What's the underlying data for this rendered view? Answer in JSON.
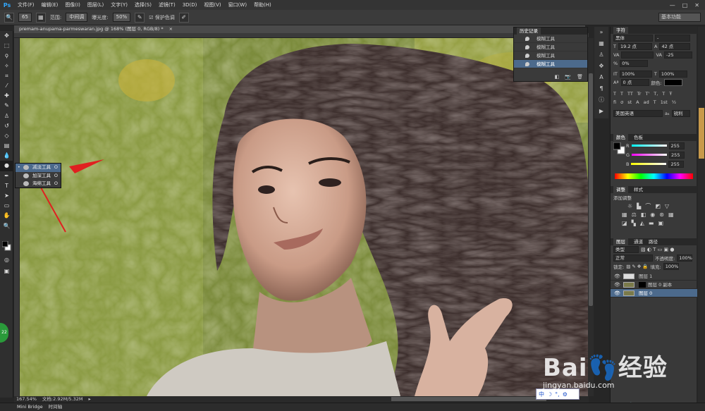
{
  "app": {
    "logo": "Ps"
  },
  "menu": [
    "文件(F)",
    "编辑(E)",
    "图像(I)",
    "图层(L)",
    "文字(Y)",
    "选择(S)",
    "滤镜(T)",
    "3D(D)",
    "视图(V)",
    "窗口(W)",
    "帮助(H)"
  ],
  "window_controls": [
    "—",
    "□",
    "✕"
  ],
  "options": {
    "size": "65",
    "range_label": "范围:",
    "range_value": "中间调",
    "exposure_label": "曝光度:",
    "exposure_value": "50%",
    "protect_label": "保护色调",
    "workspace": "基本功能"
  },
  "document": {
    "tab": "premam-anupama-parmeswaran.jpg @ 168% (图层 0, RGB/8) *",
    "close": "×"
  },
  "flyout": {
    "items": [
      {
        "label": "减淡工具",
        "key": "O",
        "selected": true
      },
      {
        "label": "加深工具",
        "key": "O",
        "selected": false
      },
      {
        "label": "海绵工具",
        "key": "O",
        "selected": false
      }
    ]
  },
  "history": {
    "title": "历史记录",
    "items": [
      "模糊工具",
      "模糊工具",
      "模糊工具",
      "模糊工具"
    ],
    "selected_index": 3
  },
  "character": {
    "tab": "字符",
    "font_family": "黑体",
    "font_style": "-",
    "size": "19.2 点",
    "leading": "42 点",
    "tracking_label": "VA",
    "tracking": "-25",
    "scale_pct": "0%",
    "vscale": "100%",
    "hscale": "100%",
    "baseline": "0 点",
    "color_label": "颜色:",
    "style_buttons": [
      "T",
      "T",
      "TT",
      "Tr",
      "T'",
      "T,",
      "T",
      "Ŧ"
    ],
    "opentype_buttons": [
      "fi",
      "σ",
      "st",
      "A",
      "ad",
      "T",
      "1st",
      "½"
    ],
    "language": "美国英语",
    "aa": "锐利"
  },
  "color": {
    "tabs": [
      "颜色",
      "色板"
    ],
    "channels": [
      {
        "label": "R",
        "value": "255",
        "color": "#ff4f4f"
      },
      {
        "label": "G",
        "value": "255",
        "color": "#7fe37f"
      },
      {
        "label": "B",
        "value": "255",
        "color": "#6f6fff"
      }
    ]
  },
  "adjustments": {
    "tabs": [
      "调整",
      "样式"
    ],
    "label": "添加调整"
  },
  "layers": {
    "tabs": [
      "图层",
      "通道",
      "路径"
    ],
    "kind": "类型",
    "blend": "正常",
    "opacity_label": "不透明度:",
    "opacity": "100%",
    "lock_label": "锁定:",
    "fill_label": "填充:",
    "fill": "100%",
    "items": [
      {
        "name": "图层 1",
        "selected": false
      },
      {
        "name": "图层 0 副本",
        "selected": false
      },
      {
        "name": "图层 0",
        "selected": true
      }
    ],
    "footer": [
      "fx",
      "◐",
      "▭",
      "📁",
      "▤",
      "🗑"
    ]
  },
  "status": {
    "zoom": "167.54%",
    "doc": "文档:2.92M/5.32M"
  },
  "bottom_tabs": [
    "Mini Bridge",
    "时间轴"
  ],
  "ime": {
    "items": [
      "中",
      "☽",
      "°,",
      "⚙"
    ]
  },
  "watermark": {
    "brand": "Bai👣经验",
    "url": "jingyan.baidu.com"
  },
  "colors": {
    "accent": "#4c6a8c",
    "arrow": "#e02020"
  }
}
